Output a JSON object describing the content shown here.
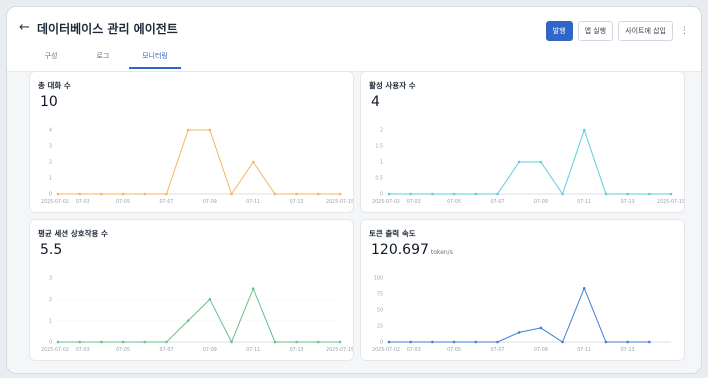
{
  "header": {
    "back_symbol": "←",
    "title": "데이터베이스 관리 에이전트",
    "buttons": {
      "publish": "발행",
      "run": "앱 실행",
      "embed": "사이트에 삽입",
      "more": "⋮"
    }
  },
  "tabs": [
    "구성",
    "로그",
    "모니터링"
  ],
  "cards": [
    {
      "title": "총 대화 수",
      "value": "10",
      "unit": ""
    },
    {
      "title": "활성 사용자 수",
      "value": "4",
      "unit": ""
    },
    {
      "title": "평균 세션 상호작용 수",
      "value": "5.5",
      "unit": ""
    },
    {
      "title": "토큰 출력 속도",
      "value": "120.697",
      "unit": "token/s"
    }
  ],
  "colors": {
    "orange": "#f2b75e",
    "cyan": "#5fcbe0",
    "green": "#66c28a",
    "blue": "#3e7dd8",
    "primary": "#2f66c8"
  },
  "chart_data": [
    {
      "type": "line",
      "title": "총 대화 수",
      "x": [
        "2025-07-02",
        "2025-07-03",
        "2025-07-04",
        "2025-07-05",
        "2025-07-06",
        "2025-07-07",
        "2025-07-08",
        "2025-07-09",
        "2025-07-10",
        "2025-07-11",
        "2025-07-12",
        "2025-07-13",
        "2025-07-14",
        "2025-07-15"
      ],
      "values": [
        0,
        0,
        0,
        0,
        0,
        0,
        4,
        4,
        0,
        2,
        0,
        0,
        0,
        0
      ],
      "ylim": [
        0,
        4
      ],
      "yticks": [
        0,
        1,
        2,
        3,
        4
      ],
      "xticks": [
        "2025-07-02",
        "07-03",
        "07-05",
        "07-07",
        "07-09",
        "07-11",
        "07-13",
        "2025-07-15"
      ]
    },
    {
      "type": "line",
      "title": "활성 사용자 수",
      "x": [
        "2025-07-02",
        "2025-07-03",
        "2025-07-04",
        "2025-07-05",
        "2025-07-06",
        "2025-07-07",
        "2025-07-08",
        "2025-07-09",
        "2025-07-10",
        "2025-07-11",
        "2025-07-12",
        "2025-07-13",
        "2025-07-14",
        "2025-07-15"
      ],
      "values": [
        0,
        0,
        0,
        0,
        0,
        0,
        1,
        1,
        0,
        2,
        0,
        0,
        0,
        0
      ],
      "ylim": [
        0,
        2
      ],
      "yticks": [
        0,
        0.5,
        1,
        1.5,
        2
      ],
      "xticks": [
        "2025-07-02",
        "07-03",
        "07-05",
        "07-07",
        "07-09",
        "07-11",
        "07-13",
        "2025-07-15"
      ]
    },
    {
      "type": "line",
      "title": "평균 세션 상호작용 수",
      "x": [
        "2025-07-02",
        "2025-07-03",
        "2025-07-04",
        "2025-07-05",
        "2025-07-06",
        "2025-07-07",
        "2025-07-08",
        "2025-07-09",
        "2025-07-10",
        "2025-07-11",
        "2025-07-12",
        "2025-07-13",
        "2025-07-14",
        "2025-07-15"
      ],
      "values": [
        0,
        0,
        0,
        0,
        0,
        0,
        1,
        2,
        0,
        2.5,
        0,
        0,
        0,
        0
      ],
      "ylim": [
        0,
        3
      ],
      "yticks": [
        0,
        1,
        2,
        3
      ],
      "xticks": [
        "2025-07-02",
        "07-03",
        "07-05",
        "07-07",
        "07-09",
        "07-11",
        "07-13",
        "2025-07-15"
      ]
    },
    {
      "type": "line",
      "title": "토큰 출력 속도",
      "x": [
        "2025-07-02",
        "2025-07-03",
        "2025-07-04",
        "2025-07-05",
        "2025-07-06",
        "2025-07-07",
        "2025-07-08",
        "2025-07-09",
        "2025-07-10",
        "2025-07-11",
        "2025-07-12",
        "2025-07-13",
        "2025-07-14"
      ],
      "values": [
        0,
        0,
        0,
        0,
        0,
        0,
        15,
        22,
        0,
        84,
        0,
        0,
        0
      ],
      "ylim": [
        0,
        100
      ],
      "yticks": [
        0,
        25,
        50,
        75,
        100
      ],
      "xticks": [
        "2025-07-02",
        "07-03",
        "07-05",
        "07-07",
        "07-09",
        "07-11",
        "07-13"
      ]
    }
  ]
}
